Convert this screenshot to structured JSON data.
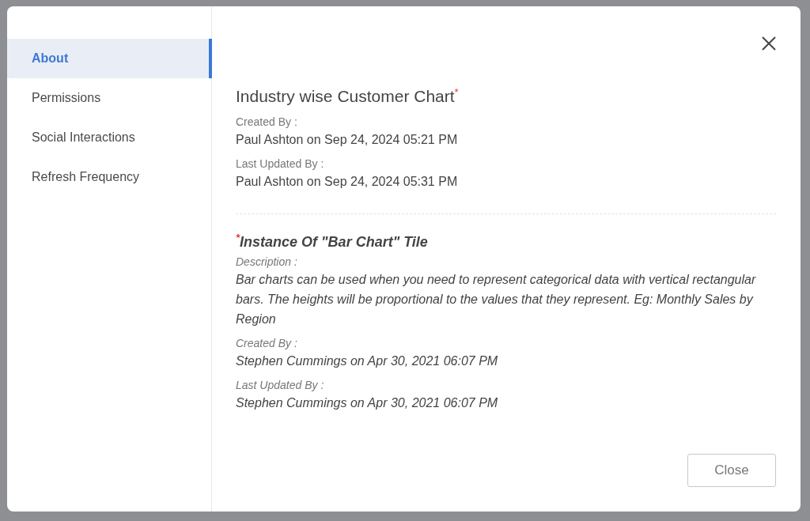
{
  "sidebar": {
    "items": [
      {
        "label": "About",
        "selected": true
      },
      {
        "label": "Permissions",
        "selected": false
      },
      {
        "label": "Social Interactions",
        "selected": false
      },
      {
        "label": "Refresh Frequency",
        "selected": false
      }
    ]
  },
  "chart_info": {
    "title": "Industry wise Customer Chart$^{*}$",
    "fields": [
      {
        "label": "Created By :",
        "value": "Paul Ashton on Sep 24, 2024 05:21 PM"
      },
      {
        "label": "Last Updated By :",
        "value": "Paul Ashton on Sep 24, 2024 05:31 PM"
      }
    ]
  },
  "tile_info": {
    "title": "$^{*}$Instance Of \"Bar Chart\" Tile",
    "fields": [
      {
        "label": "Description :",
        "value": "Bar charts can be used when you need to represent categorical data with vertical rectangular bars. The heights will be proportional to the values that they represent. Eg: Monthly Sales by Region"
      },
      {
        "label": "Created By :",
        "value": "Stephen Cummings on Apr 30, 2021 06:07 PM"
      },
      {
        "label": "Last Updated By :",
        "value": "Stephen Cummings on Apr 30, 2021 06:07 PM"
      }
    ]
  },
  "buttons": [
    "Close"
  ]
}
